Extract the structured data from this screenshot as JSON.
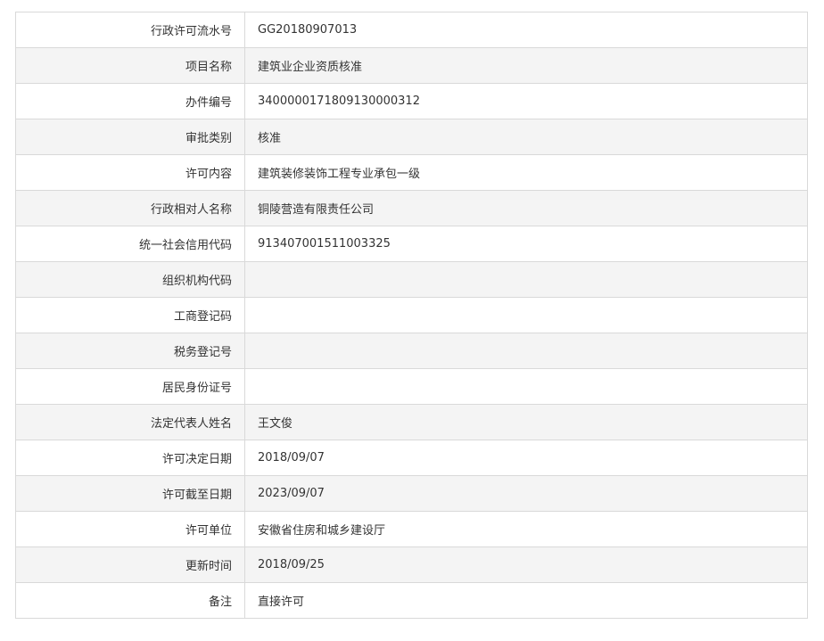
{
  "rows": [
    {
      "label": "行政许可流水号",
      "value": "GG20180907013"
    },
    {
      "label": "项目名称",
      "value": "建筑业企业资质核准"
    },
    {
      "label": "办件编号",
      "value": "340000017180913000031​2"
    },
    {
      "label": "审批类别",
      "value": "核准"
    },
    {
      "label": "许可内容",
      "value": "建筑装修装饰工程专业承包一级"
    },
    {
      "label": "行政相对人名称",
      "value": "铜陵营造有限责任公司"
    },
    {
      "label": "统一社会信用代码",
      "value": "913407001511003325"
    },
    {
      "label": "组织机构代码",
      "value": ""
    },
    {
      "label": "工商登记码",
      "value": ""
    },
    {
      "label": "税务登记号",
      "value": ""
    },
    {
      "label": "居民身份证号",
      "value": ""
    },
    {
      "label": "法定代表人姓名",
      "value": "王文俊"
    },
    {
      "label": "许可决定日期",
      "value": "2018/09/07"
    },
    {
      "label": "许可截至日期",
      "value": "2023/09/07"
    },
    {
      "label": "许可单位",
      "value": "安徽省住房和城乡建设厅"
    },
    {
      "label": "更新时间",
      "value": "2018/09/25"
    },
    {
      "label": "备注",
      "value": "直接许可"
    }
  ]
}
